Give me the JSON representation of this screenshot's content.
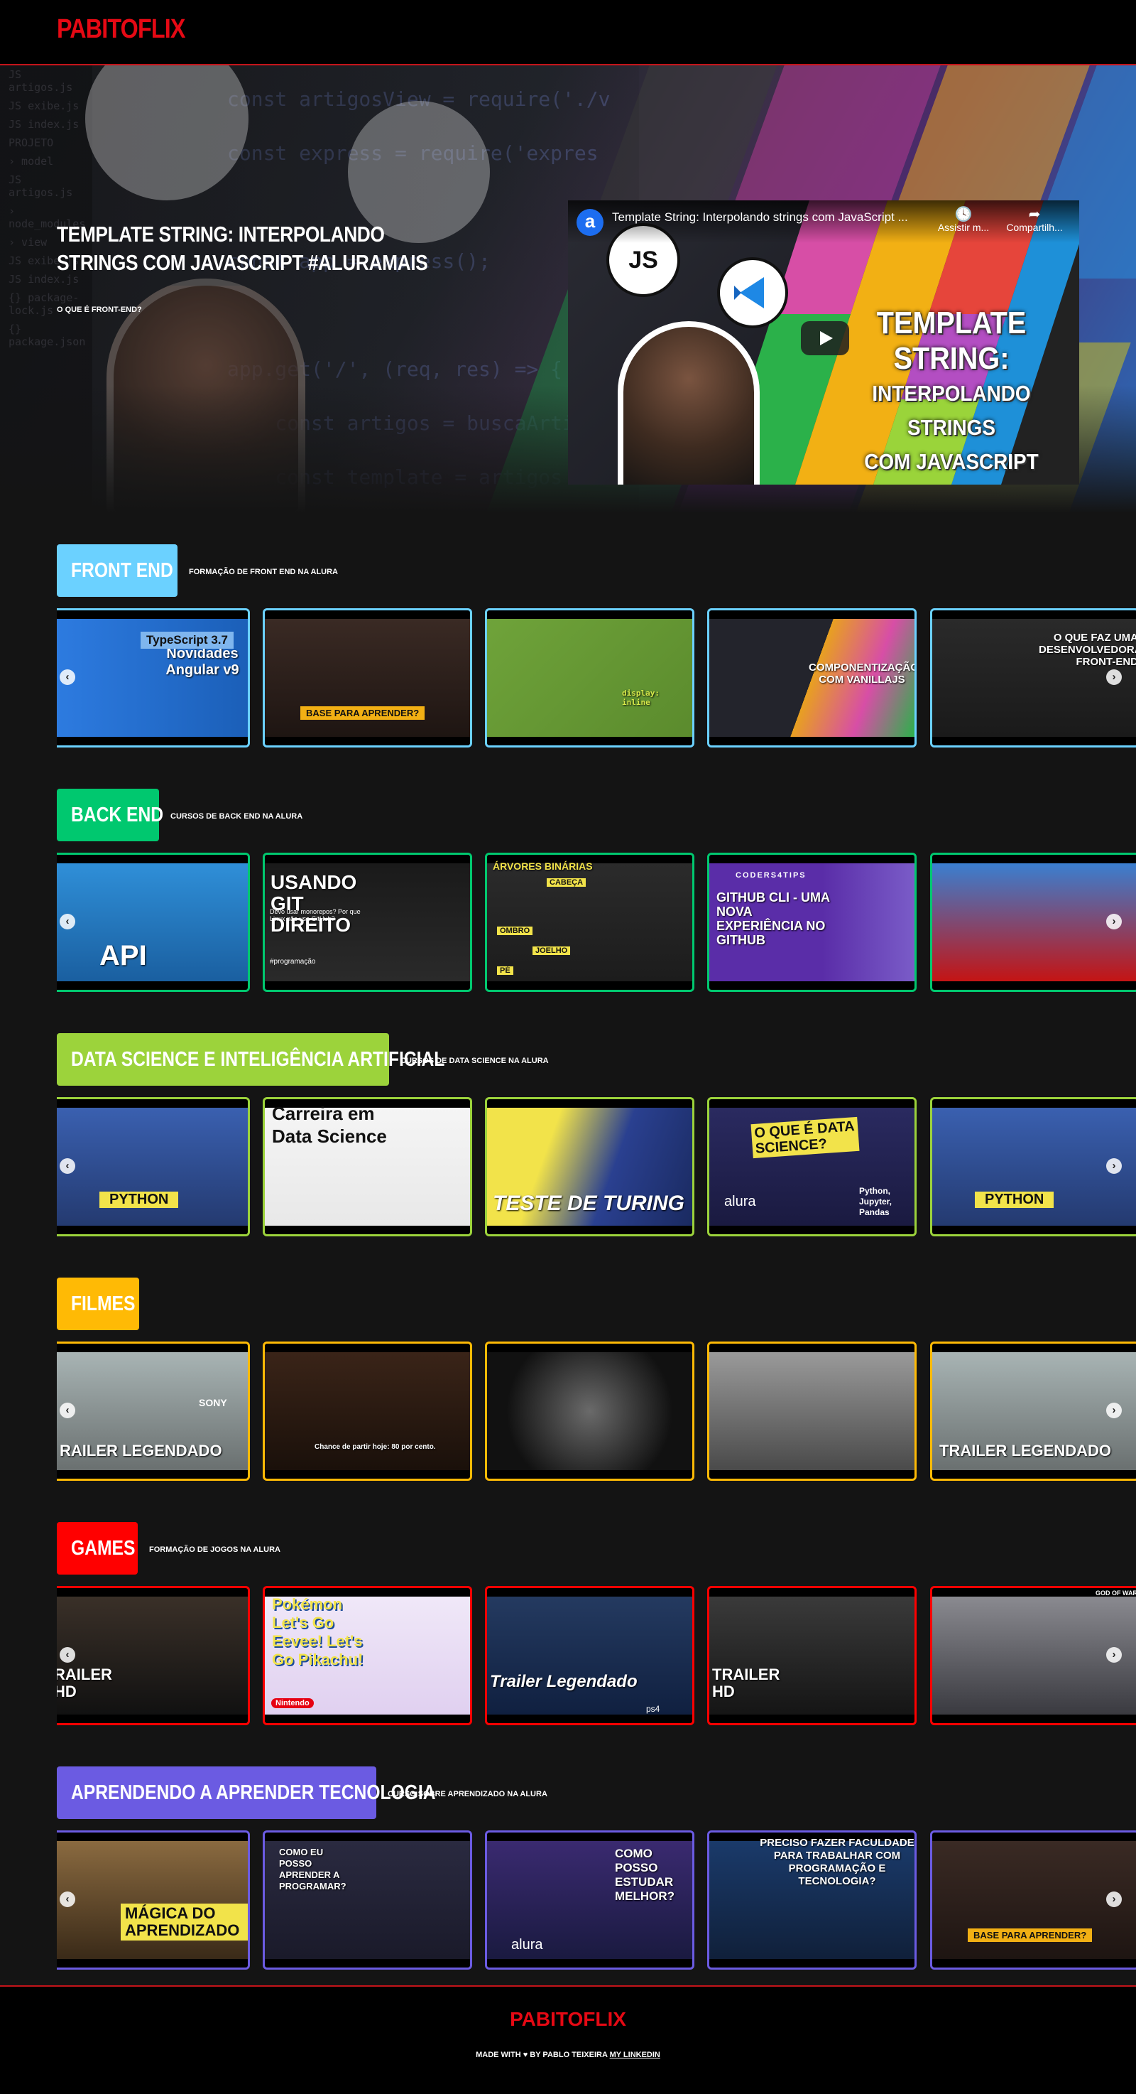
{
  "header": {
    "logo": "PABITOFLIX"
  },
  "banner": {
    "title": "Template String: Interpolando strings com JavaScript #AluraMais",
    "subtitle": "O que é Front-end?",
    "video": {
      "title": "Template String: Interpolando strings com JavaScript ...",
      "watch_later": "Assistir m...",
      "share": "Compartilh...",
      "heading_line1": "TEMPLATE STRING:",
      "heading_line2": "INTERPOLANDO STRINGS",
      "heading_line3": "COM JAVASCRIPT",
      "js_badge": "JS"
    }
  },
  "sections": [
    {
      "title": "Front End",
      "description": "Formação de Front End na Alura",
      "color": "#6bd1ff",
      "cards": [
        {
          "caption": "Novidades Angular v9"
        },
        {
          "caption": "BASE PARA APRENDER?"
        },
        {
          "caption": "display: inline"
        },
        {
          "caption": "COMPONENTIZAÇÃO COM VANILLAJS"
        },
        {
          "caption": "O QUE FAZ UMA DESENVOLVEDORA FRONT-END"
        }
      ],
      "extra": {
        "typescript": "TypeScript 3.7"
      }
    },
    {
      "title": "Back End",
      "description": "Cursos de Back End na Alura",
      "color": "#00c86f",
      "cards": [
        {
          "caption": "API"
        },
        {
          "caption": "USANDO GIT DIREITO"
        },
        {
          "caption": "ÁRVORES BINÁRIAS"
        },
        {
          "caption": "GITHUB CLI - UMA NOVA EXPERIÊNCIA NO GITHUB"
        },
        {
          "caption": ""
        }
      ],
      "extra": {
        "git_sub": "Devo usar monorepos? Por que Linux não usa GitHub?",
        "git_tag": "#programação",
        "coders": "CODERS4TIPS",
        "tree_labels": [
          "CABEÇA",
          "OMBRO",
          "JOELHO",
          "PÉ"
        ]
      }
    },
    {
      "title": "Data Science e Inteligência Artificial",
      "description": "Cursos de Data Science na Alura",
      "color": "#9cd33b",
      "cards": [
        {
          "caption": "PYTHON"
        },
        {
          "caption": "Carreira em Data Science"
        },
        {
          "caption": "TESTE DE TURING"
        },
        {
          "caption": "O QUE É DATA SCIENCE?"
        },
        {
          "caption": "PYTHON"
        }
      ],
      "extra": {
        "alura": "alura",
        "ds_side": "Python, Jupyter, Pandas"
      }
    },
    {
      "title": "Filmes",
      "description": "",
      "color": "#ffba05",
      "cards": [
        {
          "caption": "RAILER LEGENDADO"
        },
        {
          "caption": "Chance de partir hoje: 80 por cento."
        },
        {
          "caption": ""
        },
        {
          "caption": ""
        },
        {
          "caption": "TRAILER LEGENDADO"
        }
      ],
      "extra": {
        "sony": "SONY"
      }
    },
    {
      "title": "Games",
      "description": "Formação de jogos na Alura",
      "color": "#ff0000",
      "cards": [
        {
          "caption": "RAILER HD"
        },
        {
          "caption": "Pokémon Let's Go Eevee! Let's Go Pikachu!"
        },
        {
          "caption": "Trailer Legendado"
        },
        {
          "caption": "TRAILER HD"
        },
        {
          "caption": "GOD OF WAR"
        }
      ],
      "extra": {
        "nintendo": "Nintendo",
        "ps": "ps4"
      }
    },
    {
      "title": "Aprendendo a aprender tecnologia",
      "description": "Curso sobre aprendizado na Alura",
      "color": "#6b5be2",
      "cards": [
        {
          "caption": "MÁGICA DO APRENDIZADO"
        },
        {
          "caption": "COMO EU POSSO APRENDER A PROGRAMAR?"
        },
        {
          "caption": "COMO POSSO ESTUDAR MELHOR?"
        },
        {
          "caption": "PRECISO FAZER FACULDADE PARA TRABALHAR COM PROGRAMAÇÃO E TECNOLOGIA?"
        },
        {
          "caption": "BASE PARA APRENDER?"
        }
      ],
      "extra": {
        "alura": "alura"
      }
    }
  ],
  "footer": {
    "logo": "PABITOFLIX",
    "text": "Made with ♥ by Pablo Teixeira",
    "link": "My Linkedin"
  },
  "icons": {
    "prev": "‹",
    "next": "›",
    "clock": "🕓",
    "share": "➦"
  }
}
